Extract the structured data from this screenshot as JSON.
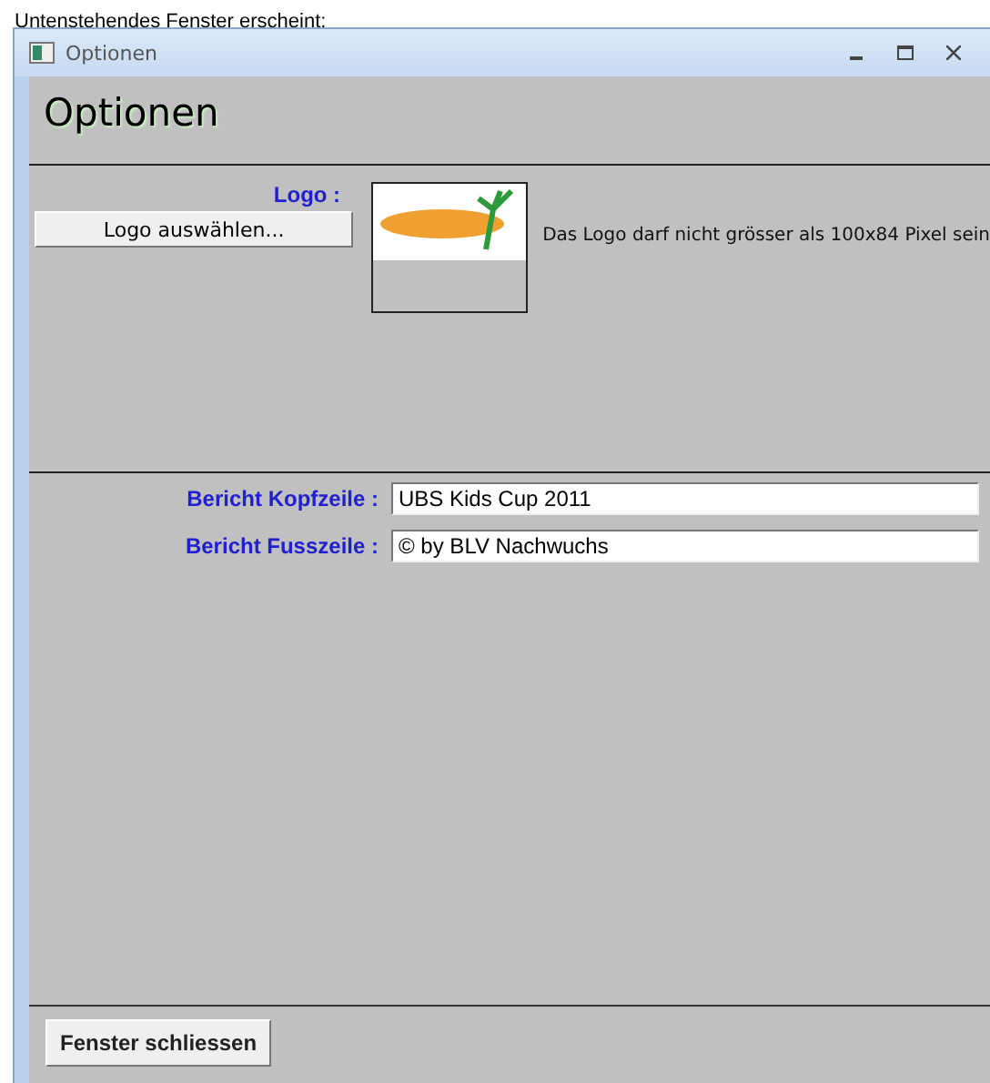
{
  "caption": "Untenstehendes Fenster erscheint:",
  "window": {
    "title": "Optionen"
  },
  "heading": "Optionen",
  "logo": {
    "label": "Logo :",
    "button": "Logo auswählen...",
    "hint": "Das Logo darf nicht grösser als 100x84 Pixel sein"
  },
  "fields": [
    {
      "label": "Bericht Kopfzeile :",
      "value": "UBS Kids Cup 2011"
    },
    {
      "label": "Bericht Fusszeile :",
      "value": "© by BLV Nachwuchs"
    }
  ],
  "footer_button": "Fenster schliessen"
}
